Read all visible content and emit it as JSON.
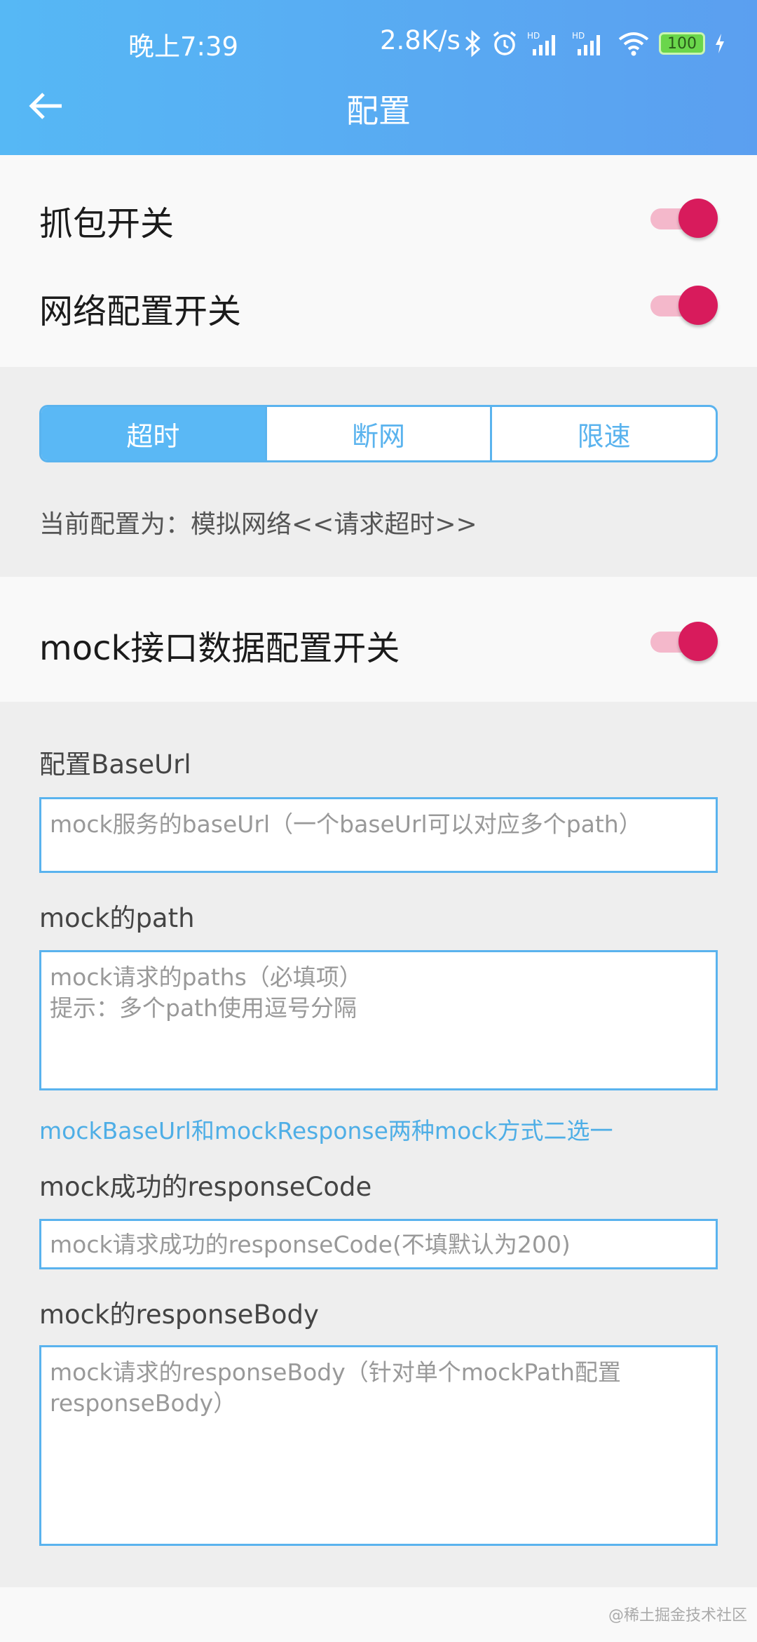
{
  "status_bar": {
    "time": "晚上7:39",
    "net_speed": "2.8K/s",
    "battery": "100",
    "icons": [
      "bluetooth-icon",
      "alarm-icon",
      "hd-signal-icon",
      "hd-signal-icon",
      "wifi-icon",
      "battery-icon",
      "charging-icon"
    ]
  },
  "header": {
    "title": "配置"
  },
  "capture": {
    "capture_label": "抓包开关",
    "capture_on": true,
    "network_label": "网络配置开关",
    "network_on": true
  },
  "network": {
    "tabs": [
      {
        "label": "超时",
        "active": true
      },
      {
        "label": "断网",
        "active": false
      },
      {
        "label": "限速",
        "active": false
      }
    ],
    "current_config": "当前配置为：模拟网络<<请求超时>>"
  },
  "mock": {
    "switch_label": "mock接口数据配置开关",
    "switch_on": true,
    "base_url_label": "配置BaseUrl",
    "base_url_placeholder": "mock服务的baseUrl（一个baseUrl可以对应多个path）",
    "path_label": "mock的path",
    "path_placeholder": "mock请求的paths（必填项）\n提示：多个path使用逗号分隔",
    "note": "mockBaseUrl和mockResponse两种mock方式二选一",
    "code_label": "mock成功的responseCode",
    "code_placeholder": "mock请求成功的responseCode(不填默认为200)",
    "body_label": "mock的responseBody",
    "body_placeholder": "mock请求的responseBody（针对单个mockPath配置responseBody）"
  },
  "watermark": "@稀土掘金技术社区",
  "colors": {
    "accent": "#5ab8f5",
    "switch_thumb": "#d81b5c",
    "switch_track": "#f4b8cb"
  }
}
